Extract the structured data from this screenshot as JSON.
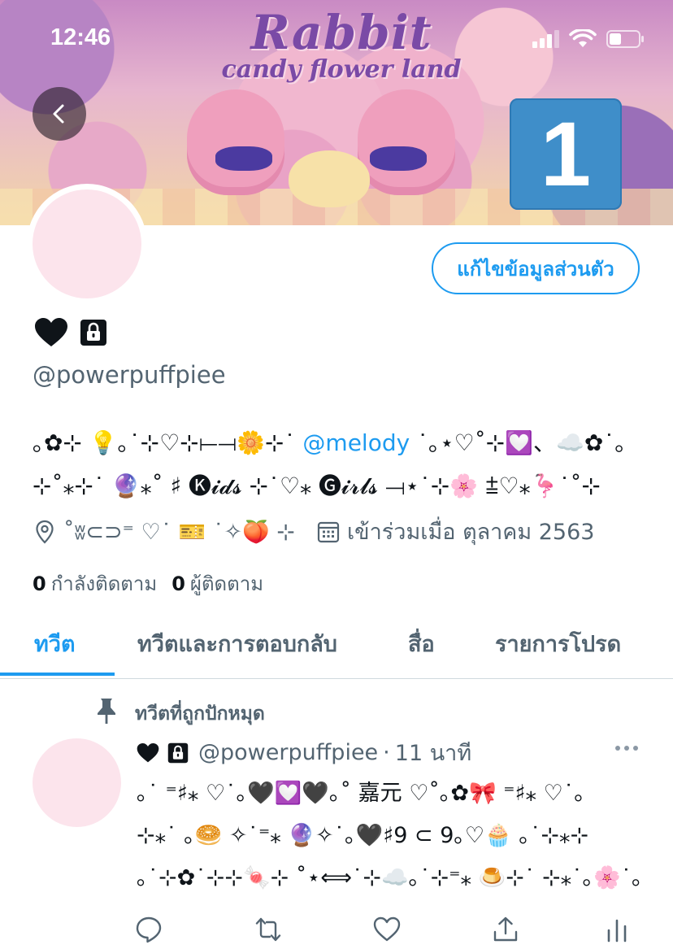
{
  "status_bar": {
    "time": "12:46"
  },
  "banner": {
    "title": "Rabbit",
    "subtitle": "candy flower land",
    "badge": "1"
  },
  "profile": {
    "edit_button": "แก้ไขข้อมูลส่วนตัว",
    "display_name": "🖤 🔒",
    "handle": "@powerpuffpiee",
    "bio_line1_prefix": "｡✿⊹ 💡｡˙⊹♡⊹⟝⟞🌼⊹˙ ",
    "bio_mention": "@melody",
    "bio_line1_suffix": " ˙｡⋆♡˚⊹💟、☁️✿˙｡",
    "bio_line2": "⊹˚⁎⊹˙ 🔮⁎˚ ♯ 🅚𝓲𝓭𝓼 ⊹˙♡⁎ 🅖𝓲𝓻𝓵𝓼 ⟞⋆˙⊹🌸 ⩲♡⁎🦩˙˚⊹",
    "location": "˚ʬ⊂⊃⁼ ♡˙ 🎫 ˙✧🍑 ⊹",
    "joined": "เข้าร่วมเมื่อ ตุลาคม 2563",
    "following_count": "0",
    "following_label": "กำลังติดตาม",
    "followers_count": "0",
    "followers_label": "ผู้ติดตาม"
  },
  "tabs": [
    "ทวีต",
    "ทวีตและการตอบกลับ",
    "สื่อ",
    "รายการโปรด"
  ],
  "pinned_tweet": {
    "pinned_label": "ทวีตที่ถูกปักหมุด",
    "author_handle": "@powerpuffpiee",
    "separator": "·",
    "time": "11 นาที",
    "body_lines": [
      "｡˙ ⁼♯⁎ ♡˙｡🖤💟🖤｡˚ 嘉元 ♡˚｡✿🎀 ⁼♯⁎ ♡˙｡",
      "⊹⁎˙ ｡🥯 ✧˙⁼⁎ 🔮✧˙｡🖤♯9 ⊂ 9｡♡🧁 ｡˙⊹⁎⊹",
      "｡˙⊹✿˙⊹⊹🍬⊹ ˚⋆⟺˙⊹☁️｡˙⊹⁼⁎ 🍮⊹˙ ⊹⁎˙｡🌸˙｡"
    ]
  },
  "colors": {
    "accent": "#1d9bf0",
    "muted": "#536471",
    "text": "#0f1419",
    "avatar_bg": "#fce4ec",
    "badge": "#3f8ec9"
  }
}
